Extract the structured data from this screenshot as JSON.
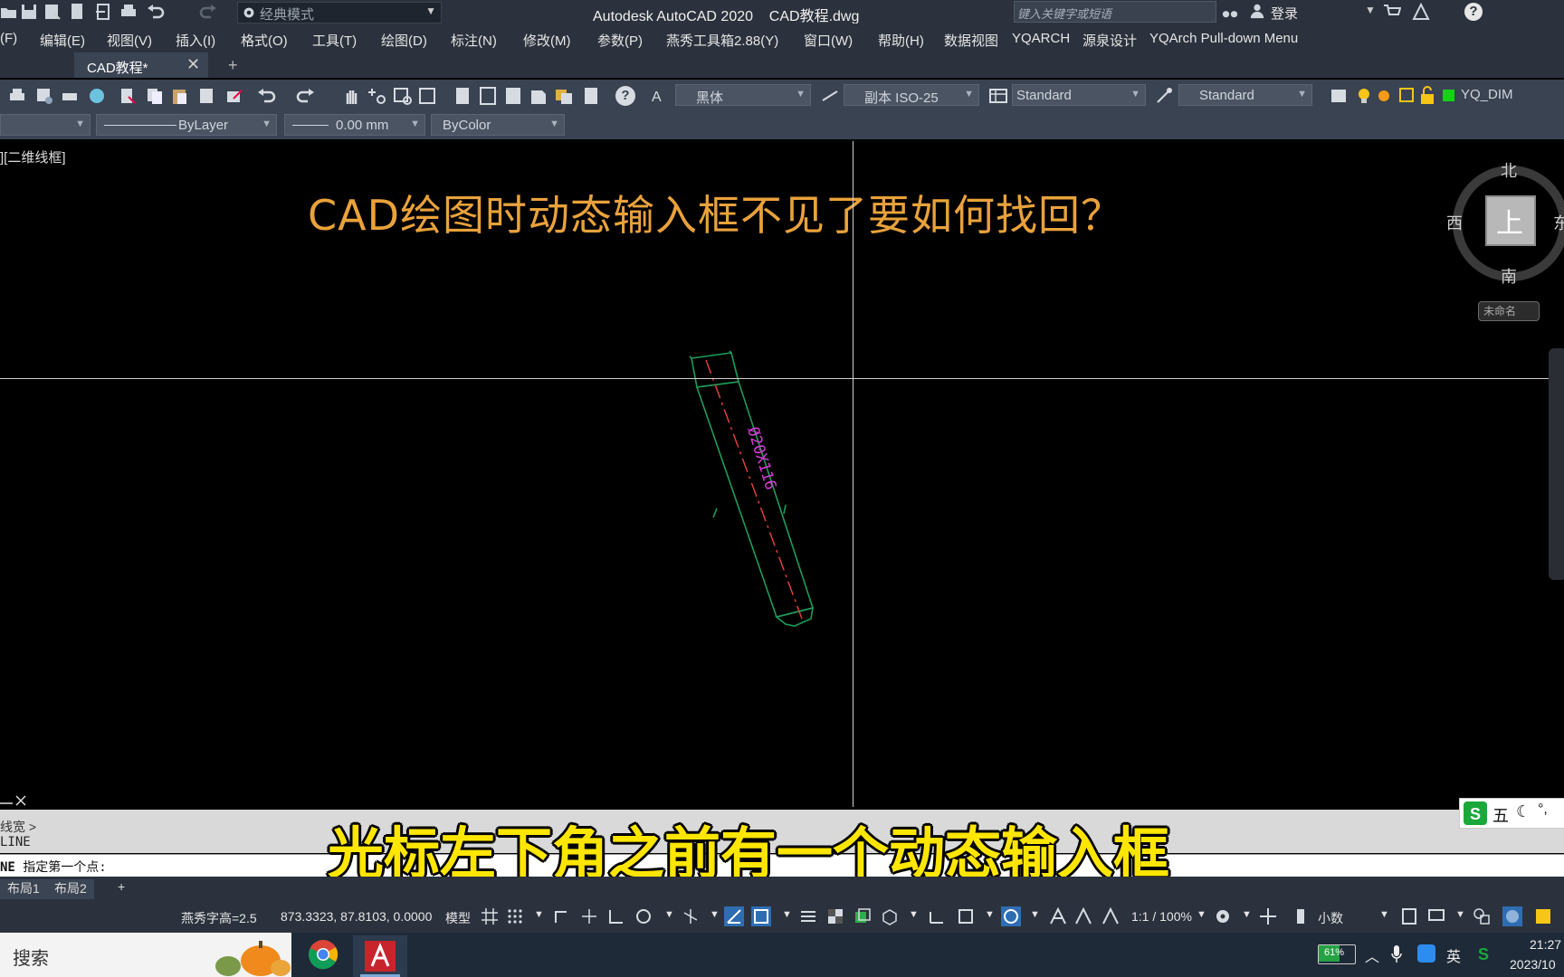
{
  "titlebar": {
    "workspace": "经典模式",
    "app_title": "Autodesk AutoCAD 2020    CAD教程.dwg",
    "search_placeholder": "键入关键字或短语",
    "login": "登录"
  },
  "menu": [
    "(F)",
    "编辑(E)",
    "视图(V)",
    "插入(I)",
    "格式(O)",
    "工具(T)",
    "绘图(D)",
    "标注(N)",
    "修改(M)",
    "参数(P)",
    "燕秀工具箱2.88(Y)",
    "窗口(W)",
    "帮助(H)",
    "数据视图",
    "YQARCH",
    "源泉设计",
    "YQArch Pull-down Menu"
  ],
  "tabs": {
    "doc": "CAD教程*",
    "close": "✕",
    "add": "+"
  },
  "toolbar1": {
    "text_style": "黑体",
    "dim_style": "副本 ISO-25",
    "table_style": "Standard",
    "multileader_style": "Standard",
    "layer": "YQ_DIM"
  },
  "toolbar2": {
    "linetype": "ByLayer",
    "lineweight": "0.00 mm",
    "plotstyle": "ByColor"
  },
  "viewport": {
    "label": "][二维线框]",
    "heading": "CAD绘图时动态输入框不见了要如何找回？",
    "part_label": "Ø20X116"
  },
  "viewcube": {
    "top": "上",
    "north": "北",
    "south": "南",
    "west": "西",
    "east": "东",
    "ucs": "未命名"
  },
  "command": {
    "history1": "线宽 >",
    "history2": "LINE",
    "prompt_prefix": "NE",
    "prompt": "指定第一个点:"
  },
  "subtitle": "光标左下角之前有一个动态输入框",
  "ime": {
    "mode": "五"
  },
  "layout_tabs": [
    "布局1",
    "布局2",
    "+"
  ],
  "status": {
    "text_height": "燕秀字高=2.5",
    "coords": "873.3323, 87.8103, 0.0000",
    "space": "模型",
    "scale": "1:1 / 100%",
    "units": "小数"
  },
  "taskbar": {
    "search": "搜索",
    "battery": "61%",
    "lang": "英",
    "time": "21:27",
    "date": "2023/10"
  },
  "colors": {
    "heading": "#e9a23b",
    "subtitle": "#ffe600",
    "part_outline": "#1e9c5a",
    "part_center": "#e23c3c",
    "part_text": "#d83cd8"
  }
}
